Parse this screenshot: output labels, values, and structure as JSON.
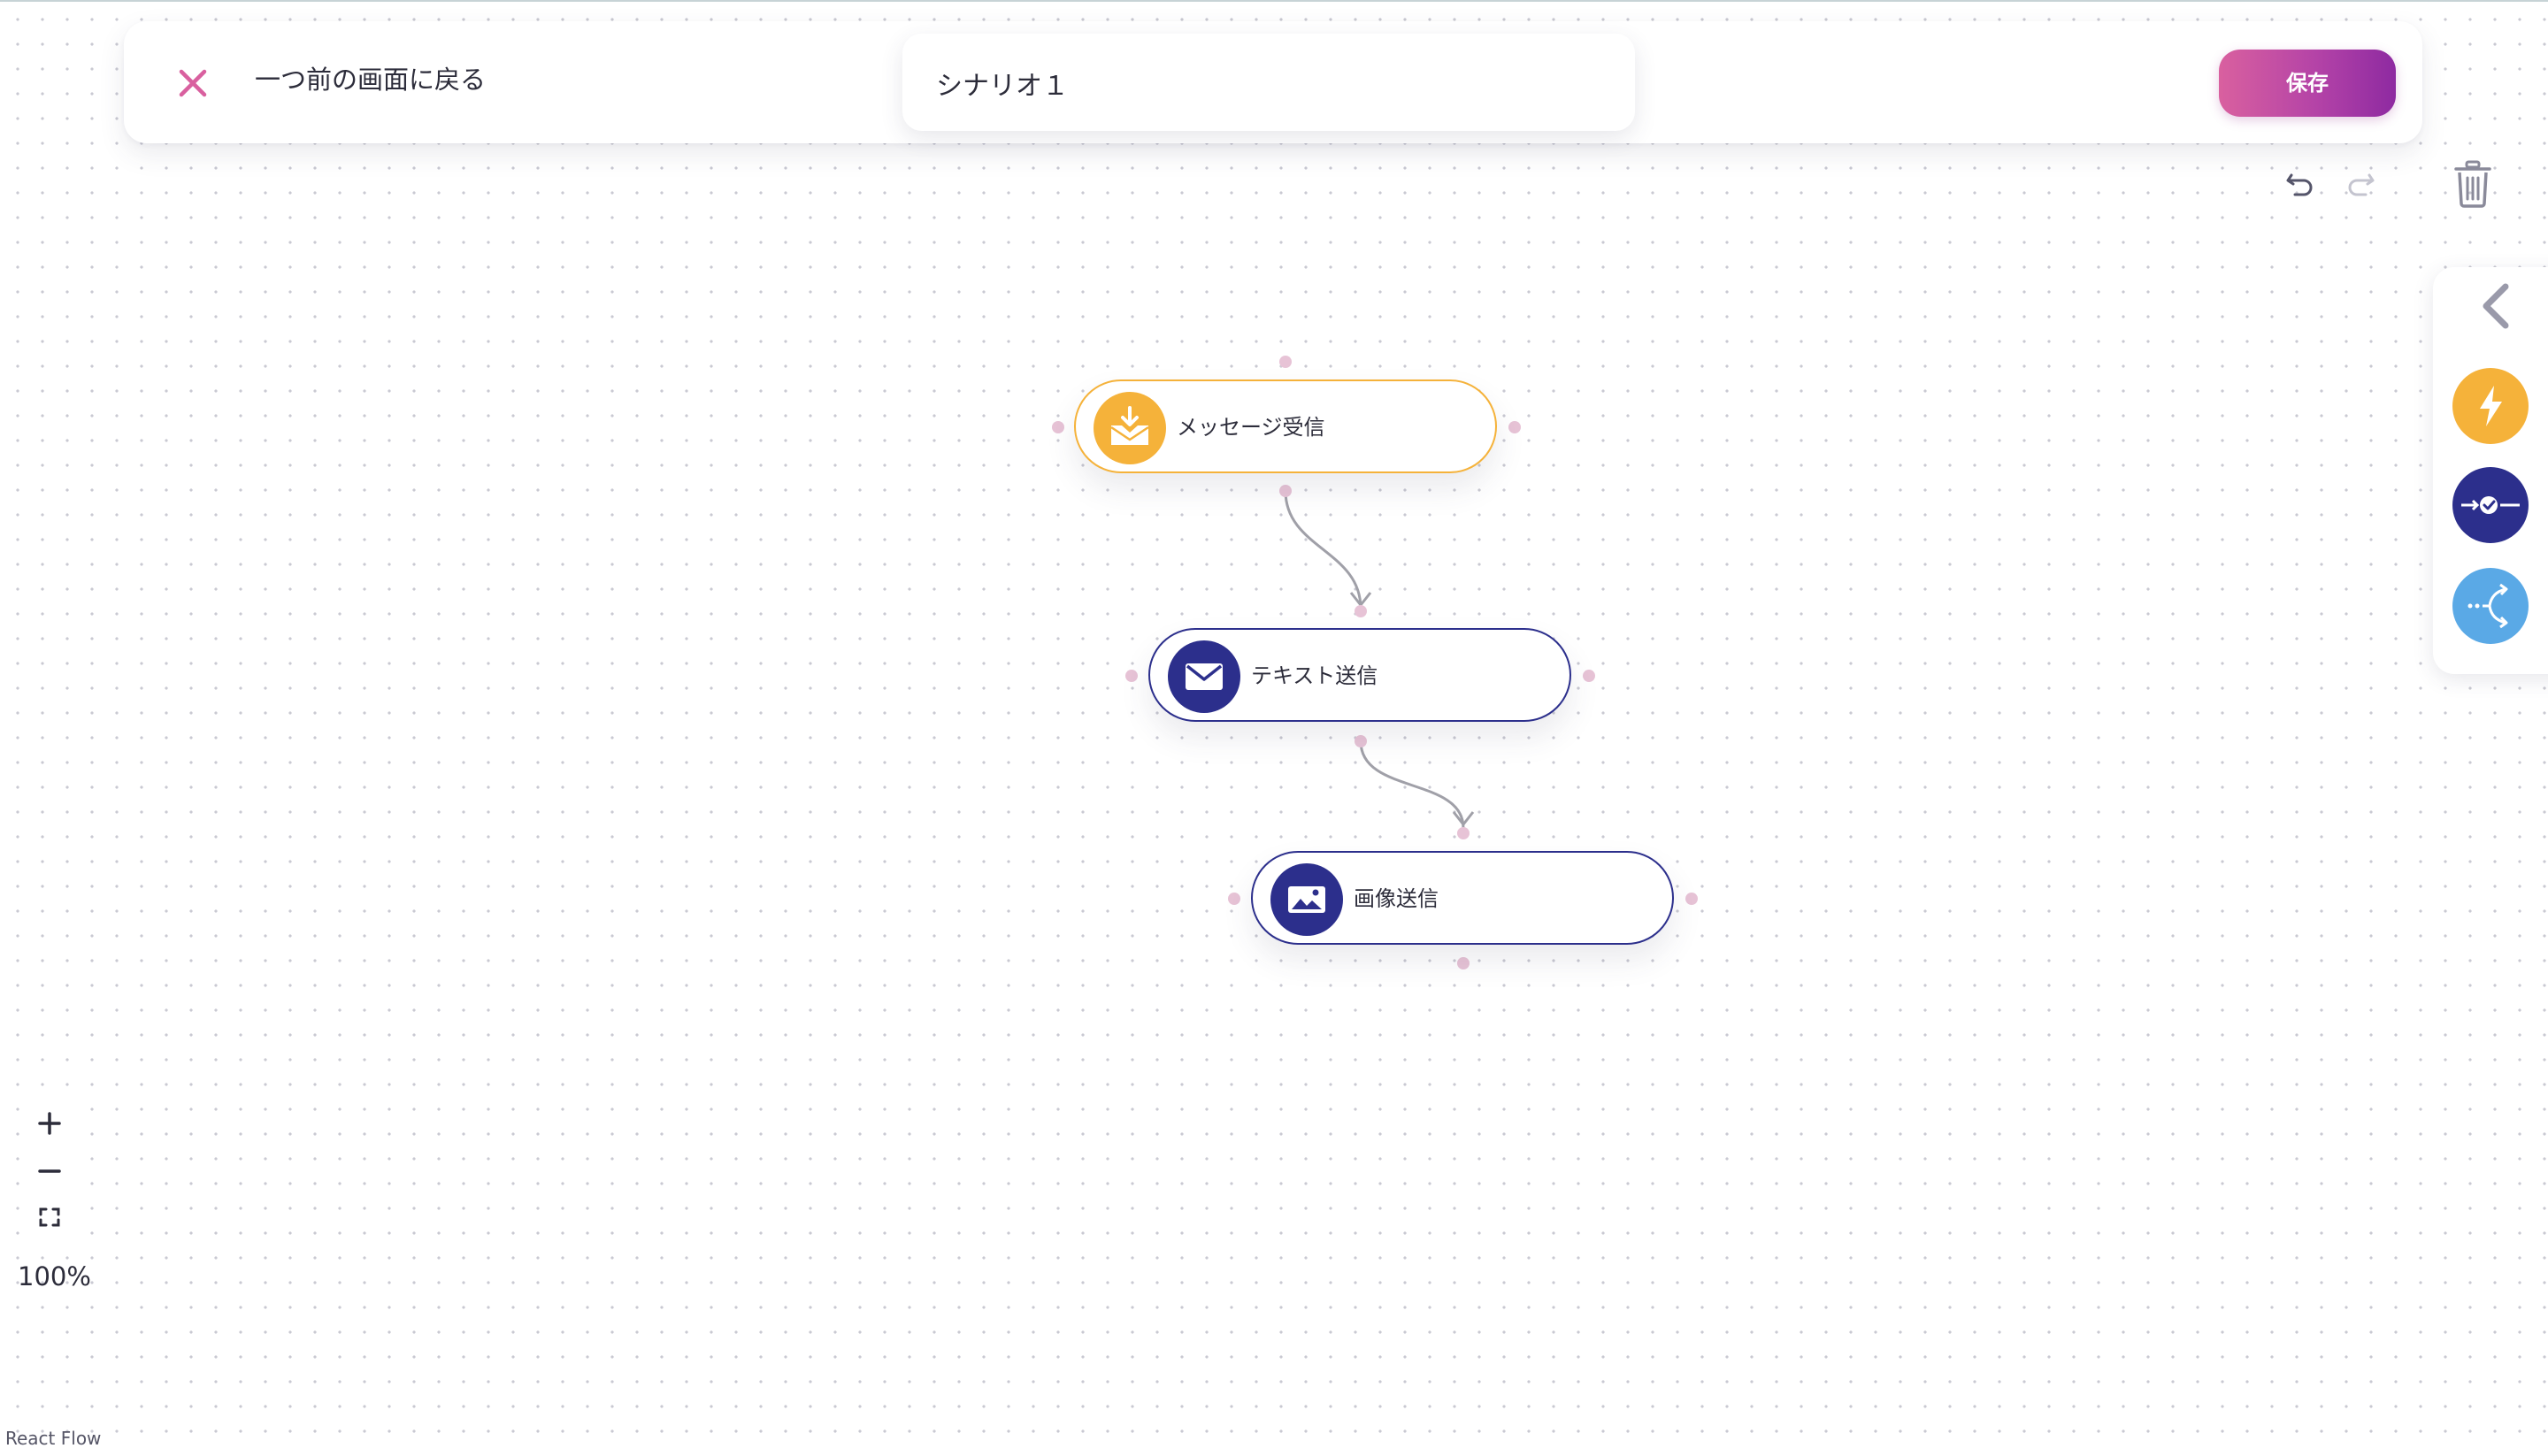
{
  "header": {
    "back_label": "一つ前の画面に戻る",
    "scenario_name": "シナリオ１",
    "save_label": "保存"
  },
  "nodes": [
    {
      "label": "メッセージ受信",
      "icon": "inbox-download-icon",
      "color": "#f5b23a"
    },
    {
      "label": "テキスト送信",
      "icon": "envelope-icon",
      "color": "#2c2f8c"
    },
    {
      "label": "画像送信",
      "icon": "image-icon",
      "color": "#2c2f8c"
    }
  ],
  "edges": [
    {
      "from": "メッセージ受信",
      "to": "テキスト送信"
    },
    {
      "from": "テキスト送信",
      "to": "画像送信"
    }
  ],
  "toolbar": {
    "undo_icon": "undo-icon",
    "redo_icon": "redo-icon",
    "delete_icon": "trash-icon"
  },
  "side_panel": {
    "collapse_icon": "chevron-left-icon",
    "buttons": [
      {
        "icon": "lightning-icon",
        "color": "#f5b23a"
      },
      {
        "icon": "action-check-icon",
        "color": "#2c2f8c"
      },
      {
        "icon": "branch-icon",
        "color": "#5aa9e6"
      }
    ]
  },
  "zoom": {
    "level": "100%",
    "zoom_in_icon": "plus-icon",
    "zoom_out_icon": "minus-icon",
    "fit_view_icon": "fit-view-icon"
  },
  "attribution": "React Flow",
  "colors": {
    "accent_pink": "#d9609f",
    "accent_purple": "#8e2aa1",
    "trigger_orange": "#f5b23a",
    "action_navy": "#2c2f8c",
    "branch_blue": "#5aa9e6",
    "handle_pink": "#e7c3d6"
  }
}
